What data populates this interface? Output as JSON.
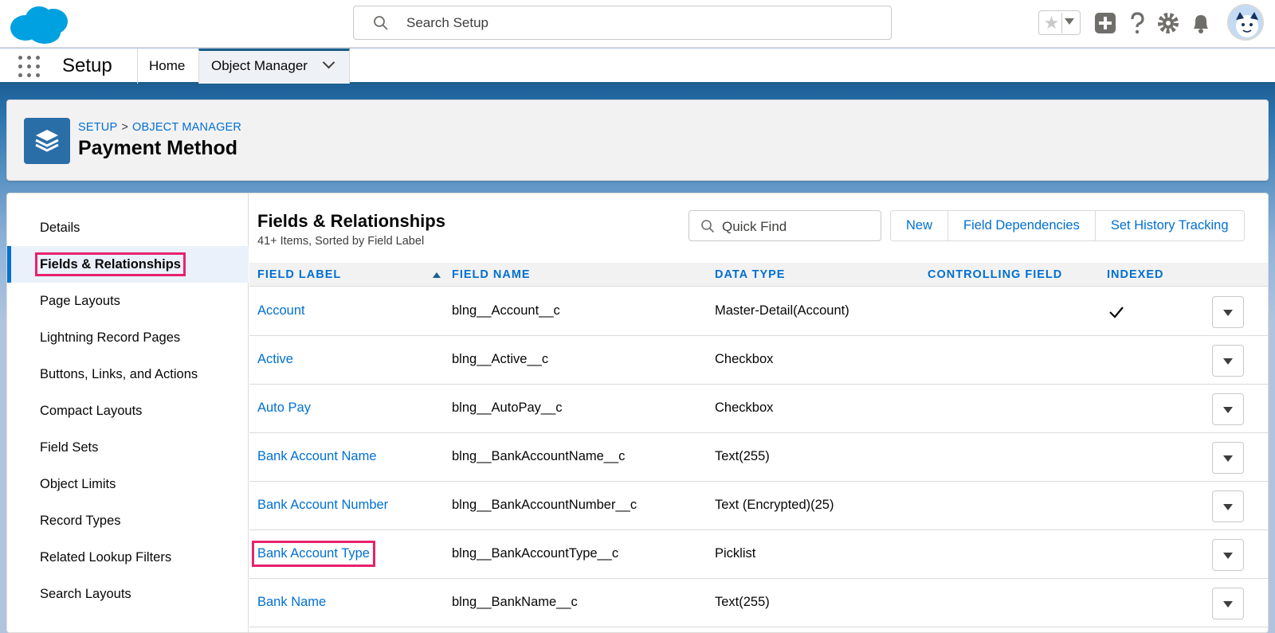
{
  "header": {
    "search_placeholder": "Search Setup",
    "star_glyph": "★",
    "icons": [
      "cloud-logo",
      "search-icon",
      "star-icon",
      "add-icon",
      "help-icon",
      "gear-icon",
      "bell-icon",
      "avatar"
    ]
  },
  "context_nav": {
    "app_name": "Setup",
    "tabs": [
      {
        "label": "Home"
      },
      {
        "label": "Object Manager"
      }
    ]
  },
  "page_header": {
    "breadcrumb": [
      "SETUP",
      "OBJECT MANAGER"
    ],
    "breadcrumb_sep": ">",
    "title": "Payment Method"
  },
  "sidebar": {
    "items": [
      {
        "label": "Details"
      },
      {
        "label": "Fields & Relationships"
      },
      {
        "label": "Page Layouts"
      },
      {
        "label": "Lightning Record Pages"
      },
      {
        "label": "Buttons, Links, and Actions"
      },
      {
        "label": "Compact Layouts"
      },
      {
        "label": "Field Sets"
      },
      {
        "label": "Object Limits"
      },
      {
        "label": "Record Types"
      },
      {
        "label": "Related Lookup Filters"
      },
      {
        "label": "Search Layouts"
      }
    ],
    "active_index": 1
  },
  "main": {
    "title": "Fields & Relationships",
    "subtitle": "41+ Items, Sorted by Field Label",
    "quick_find_placeholder": "Quick Find",
    "buttons": [
      "New",
      "Field Dependencies",
      "Set History Tracking"
    ],
    "columns": [
      "FIELD LABEL",
      "FIELD NAME",
      "DATA TYPE",
      "CONTROLLING FIELD",
      "INDEXED"
    ],
    "rows": [
      {
        "label": "Account",
        "name": "blng__Account__c",
        "type": "Master-Detail(Account)",
        "controlling": "",
        "indexed": true
      },
      {
        "label": "Active",
        "name": "blng__Active__c",
        "type": "Checkbox",
        "controlling": "",
        "indexed": false
      },
      {
        "label": "Auto Pay",
        "name": "blng__AutoPay__c",
        "type": "Checkbox",
        "controlling": "",
        "indexed": false
      },
      {
        "label": "Bank Account Name",
        "name": "blng__BankAccountName__c",
        "type": "Text(255)",
        "controlling": "",
        "indexed": false
      },
      {
        "label": "Bank Account Number",
        "name": "blng__BankAccountNumber__c",
        "type": "Text (Encrypted)(25)",
        "controlling": "",
        "indexed": false
      },
      {
        "label": "Bank Account Type",
        "name": "blng__BankAccountType__c",
        "type": "Picklist",
        "controlling": "",
        "indexed": false
      },
      {
        "label": "Bank Name",
        "name": "blng__BankName__c",
        "type": "Text(255)",
        "controlling": "",
        "indexed": false
      }
    ]
  },
  "colors": {
    "brand_blue": "#0070d2",
    "highlight": "#e8216d",
    "object_icon": "#2a6ea8"
  }
}
